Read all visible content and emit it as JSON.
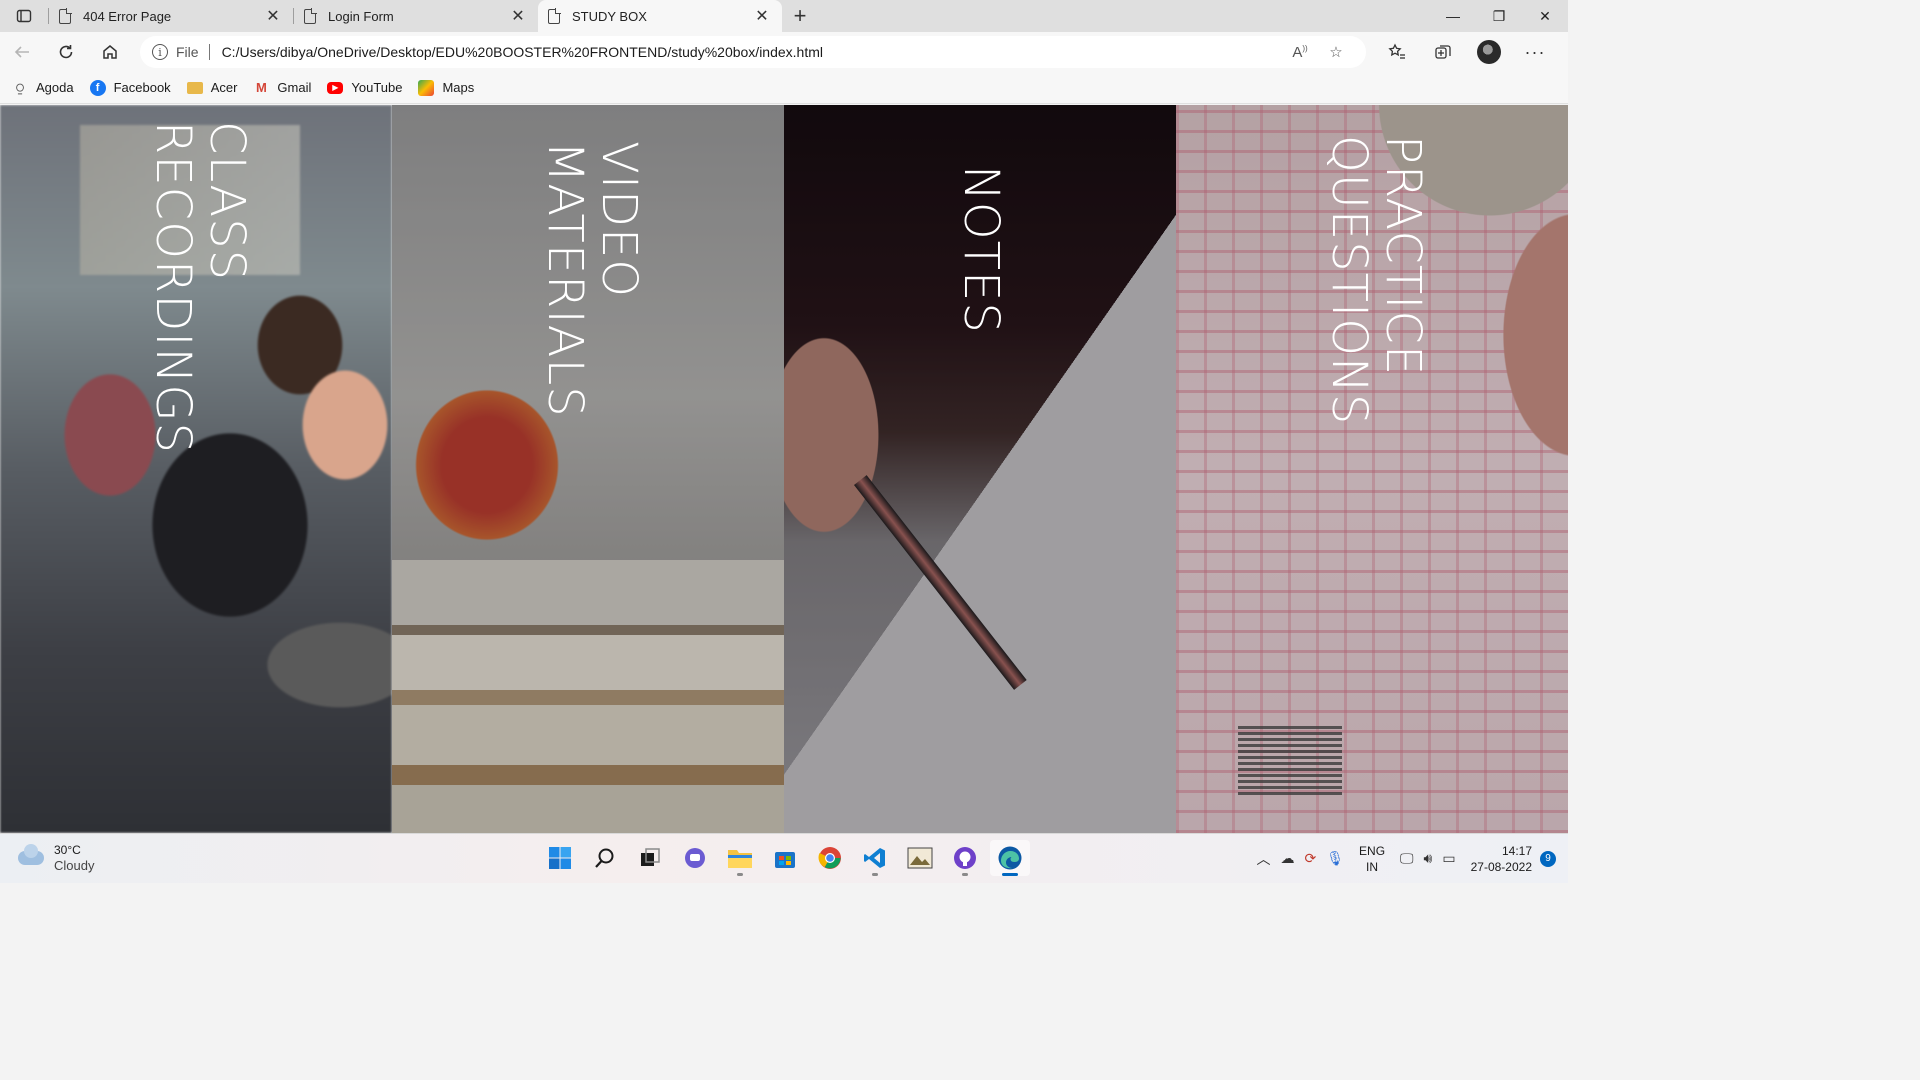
{
  "browser": {
    "tabs": [
      {
        "title": "404 Error Page",
        "close": "✕"
      },
      {
        "title": "Login Form",
        "close": "✕"
      },
      {
        "title": "STUDY BOX",
        "close": "✕",
        "active": true
      }
    ],
    "new_tab": "+",
    "window": {
      "minimize": "—",
      "restore": "❐",
      "close": "✕"
    },
    "address": {
      "scheme": "File",
      "url": "C:/Users/dibya/OneDrive/Desktop/EDU%20BOOSTER%20FRONTEND/study%20box/index.html"
    },
    "favorites": [
      {
        "label": "Agoda",
        "icon": "agoda-icon",
        "color": "#5a5a5a"
      },
      {
        "label": "Facebook",
        "icon": "facebook-icon",
        "color": "#1877f2"
      },
      {
        "label": "Acer",
        "icon": "folder-icon",
        "color": "#e8b84a"
      },
      {
        "label": "Gmail",
        "icon": "gmail-icon",
        "color": "#d44638"
      },
      {
        "label": "YouTube",
        "icon": "youtube-icon",
        "color": "#ff0000"
      },
      {
        "label": "Maps",
        "icon": "maps-icon",
        "color": "#34a853"
      }
    ]
  },
  "page": {
    "panels": [
      {
        "label": "CLASS\nRECORDINGS"
      },
      {
        "label": "VIDEO\nMATERIALS"
      },
      {
        "label": "NOTES"
      },
      {
        "label": "PRACTICE\nQUESTIONS"
      }
    ]
  },
  "taskbar": {
    "weather": {
      "temp": "30°C",
      "condition": "Cloudy"
    },
    "language": {
      "line1": "ENG",
      "line2": "IN"
    },
    "clock": {
      "time": "14:17",
      "date": "27-08-2022"
    },
    "notifications": "9",
    "accent": "#0067c0"
  }
}
